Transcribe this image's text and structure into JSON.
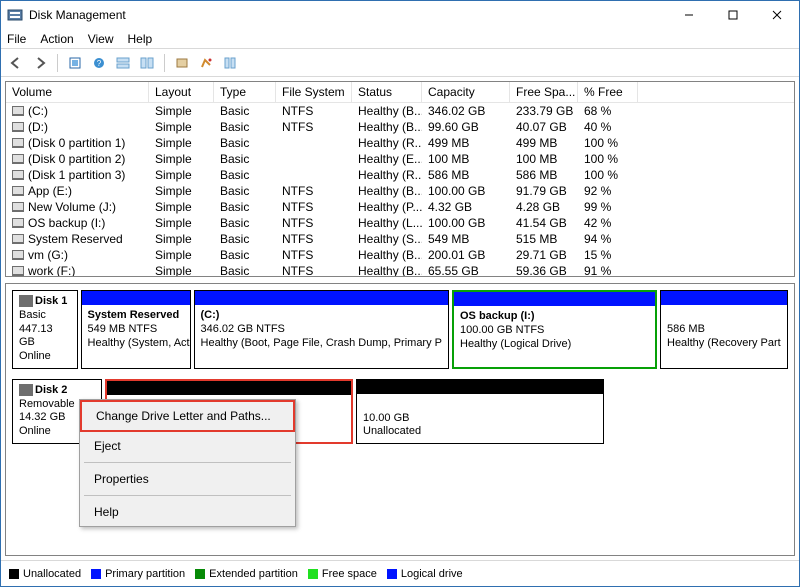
{
  "window": {
    "title": "Disk Management"
  },
  "menubar": [
    "File",
    "Action",
    "View",
    "Help"
  ],
  "columns": [
    "Volume",
    "Layout",
    "Type",
    "File System",
    "Status",
    "Capacity",
    "Free Spa...",
    "% Free"
  ],
  "volumes": [
    {
      "name": "(C:)",
      "layout": "Simple",
      "type": "Basic",
      "fs": "NTFS",
      "status": "Healthy (B...",
      "cap": "346.02 GB",
      "free": "233.79 GB",
      "pct": "68 %"
    },
    {
      "name": "(D:)",
      "layout": "Simple",
      "type": "Basic",
      "fs": "NTFS",
      "status": "Healthy (B...",
      "cap": "99.60 GB",
      "free": "40.07 GB",
      "pct": "40 %"
    },
    {
      "name": "(Disk 0 partition 1)",
      "layout": "Simple",
      "type": "Basic",
      "fs": "",
      "status": "Healthy (R...",
      "cap": "499 MB",
      "free": "499 MB",
      "pct": "100 %"
    },
    {
      "name": "(Disk 0 partition 2)",
      "layout": "Simple",
      "type": "Basic",
      "fs": "",
      "status": "Healthy (E...",
      "cap": "100 MB",
      "free": "100 MB",
      "pct": "100 %"
    },
    {
      "name": "(Disk 1 partition 3)",
      "layout": "Simple",
      "type": "Basic",
      "fs": "",
      "status": "Healthy (R...",
      "cap": "586 MB",
      "free": "586 MB",
      "pct": "100 %"
    },
    {
      "name": "App (E:)",
      "layout": "Simple",
      "type": "Basic",
      "fs": "NTFS",
      "status": "Healthy (B...",
      "cap": "100.00 GB",
      "free": "91.79 GB",
      "pct": "92 %"
    },
    {
      "name": "New Volume (J:)",
      "layout": "Simple",
      "type": "Basic",
      "fs": "NTFS",
      "status": "Healthy (P...",
      "cap": "4.32 GB",
      "free": "4.28 GB",
      "pct": "99 %"
    },
    {
      "name": "OS backup (I:)",
      "layout": "Simple",
      "type": "Basic",
      "fs": "NTFS",
      "status": "Healthy (L...",
      "cap": "100.00 GB",
      "free": "41.54 GB",
      "pct": "42 %"
    },
    {
      "name": "System Reserved",
      "layout": "Simple",
      "type": "Basic",
      "fs": "NTFS",
      "status": "Healthy (S...",
      "cap": "549 MB",
      "free": "515 MB",
      "pct": "94 %"
    },
    {
      "name": "vm (G:)",
      "layout": "Simple",
      "type": "Basic",
      "fs": "NTFS",
      "status": "Healthy (B...",
      "cap": "200.01 GB",
      "free": "29.71 GB",
      "pct": "15 %"
    },
    {
      "name": "work (F:)",
      "layout": "Simple",
      "type": "Basic",
      "fs": "NTFS",
      "status": "Healthy (B...",
      "cap": "65.55 GB",
      "free": "59.36 GB",
      "pct": "91 %"
    }
  ],
  "disks": {
    "d1": {
      "name": "Disk 1",
      "type": "Basic",
      "size": "447.13 GB",
      "state": "Online"
    },
    "d2": {
      "name": "Disk 2",
      "type": "Removable",
      "size": "14.32 GB",
      "state": "Online"
    }
  },
  "parts1": {
    "p0": {
      "title": "System Reserved",
      "sub": "549 MB NTFS",
      "status": "Healthy (System, Activ"
    },
    "p1": {
      "title": "(C:)",
      "sub": "346.02 GB NTFS",
      "status": "Healthy (Boot, Page File, Crash Dump, Primary P"
    },
    "p2": {
      "title": "OS backup  (I:)",
      "sub": "100.00 GB NTFS",
      "status": "Healthy (Logical Drive)"
    },
    "p3": {
      "title": "",
      "sub": "586 MB",
      "status": "Healthy (Recovery Part"
    }
  },
  "parts2": {
    "p0": {
      "title": "",
      "sub": "",
      "status": ""
    },
    "p1": {
      "title": "",
      "sub": "10.00 GB",
      "status": "Unallocated"
    }
  },
  "legend": {
    "unallocated": "Unallocated",
    "primary": "Primary partition",
    "extended": "Extended partition",
    "free": "Free space",
    "logical": "Logical drive"
  },
  "context": {
    "change": "Change Drive Letter and Paths...",
    "eject": "Eject",
    "properties": "Properties",
    "help": "Help"
  }
}
